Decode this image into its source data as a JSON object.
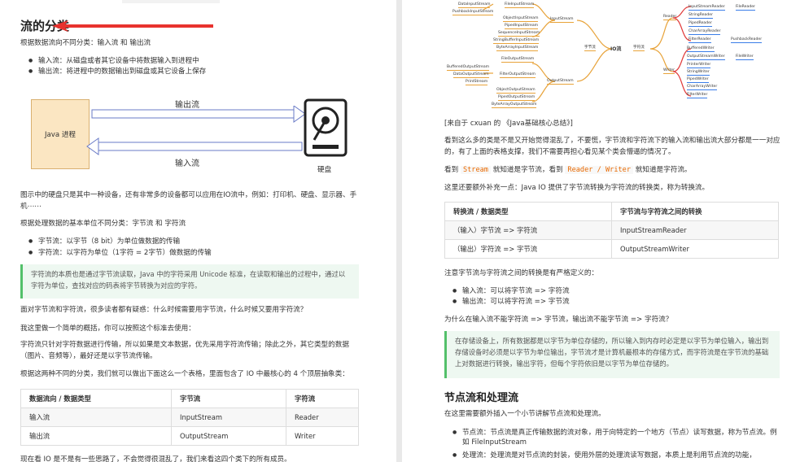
{
  "left": {
    "heading": "流的分类",
    "p1": "根据数据流向不同分类：输入流 和 输出流",
    "flow_bullets": [
      "输入流：从磁盘或者其它设备中将数据输入到进程中",
      "输出流：将进程中的数据输出到磁盘或其它设备上保存"
    ],
    "diagram": {
      "process_label": "Java 进程",
      "output_label": "输出流",
      "input_label": "输入流",
      "disk_label": "硬盘"
    },
    "p2": "图示中的硬盘只是其中一种设备，还有非常多的设备都可以应用在IO流中，例如：打印机、硬盘、显示器、手机⋯⋯",
    "p3": "根据处理数据的基本单位不同分类：字节流 和 字符流",
    "unit_bullets": [
      "字节流：以字节（8 bit）为单位做数据的传输",
      "字符流：以字符为单位（1字符 = 2字节）做数据的传输"
    ],
    "note": "字符流的本质也是通过字节流读取，Java 中的字符采用 Unicode 标准，在读取和输出的过程中，通过以字符为单位，查找对应的码表将字节转换为对应的字符。",
    "p4": "面对字节流和字符流，很多读者都有疑惑：什么时候需要用字节流，什么时候又要用字符流？",
    "p5": "我这里做一个简单的概括，你可以按照这个标准去使用：",
    "p6": "字符流只针对字符数据进行传输，所以如果是文本数据，优先采用字符流传输；除此之外，其它类型的数据（图片、音频等），最好还是以字节流传输。",
    "p7": "根据这两种不同的分类，我们就可以做出下面这么一个表格，里面包含了 IO 中最核心的 4 个顶层抽象类：",
    "table": {
      "headers": [
        "数据流向 / 数据类型",
        "字节流",
        "字符流"
      ],
      "rows": [
        [
          "输入流",
          "InputStream",
          "Reader"
        ],
        [
          "输出流",
          "OutputStream",
          "Writer"
        ]
      ]
    },
    "p8": "现在看 IO 是不是有一些思路了，不会觉得很混乱了，我们来看这四个类下的所有成员。"
  },
  "right": {
    "mindmap": {
      "center": "IO流",
      "byte": "字节流",
      "char": "字符流",
      "input_stream": "InputStream",
      "output_stream": "OutputStream",
      "reader": "Reader",
      "writer": "Writer",
      "in_children": [
        "FileInputStream",
        "ObjectInputStream",
        "PipedInputStream",
        "SequenceInputStream",
        "StringBufferInputStream",
        "ByteArrayInputStream"
      ],
      "in_far": [
        "DataInputStream",
        "PushbackInputStream"
      ],
      "out_children": [
        "FileOutputStream",
        "FilterOutputStream",
        "ObjectOutputStream",
        "PipedOutputStream",
        "ByteArrayOutputStream"
      ],
      "out_far": [
        "BufferedOutputStream",
        "DataOutputStream",
        "PrintStream"
      ],
      "reader_children": [
        "InputStreamReader",
        "StringReader",
        "PipedReader",
        "CharArrayReader",
        "FilterReader"
      ],
      "reader_far": [
        "FileReader",
        "PushbackReader"
      ],
      "writer_children": [
        "BufferedWriter",
        "OutputStreamWriter",
        "PrinterWriter",
        "StringWriter",
        "PipedWriter",
        "CharArrayWriter",
        "FilterWriter"
      ],
      "writer_far": [
        "FileWriter"
      ]
    },
    "caption": "[来自于 cxuan 的 《Java基础核心总结》]",
    "p1": "看到这么多的类是不是又开始觉得混乱了，不要慌，字节流和字符流下的输入流和输出流大部分都是一一对应的，有了上面的表格支撑，我们不需要再担心看见某个类会懵逼的情况了。",
    "p2_pre": "看到",
    "p2_code1": "Stream",
    "p2_mid": "就知道是字节流，看到",
    "p2_code2": "Reader / Writer",
    "p2_post": "就知道是字符流。",
    "p3": "这里还要额外补充一点：Java IO 提供了字节流转换为字符流的转换类，称为转换流。",
    "table": {
      "headers": [
        "转换流 / 数据类型",
        "字节流与字符流之间的转换"
      ],
      "rows": [
        [
          "（输入）字节流 => 字符流",
          "InputStreamReader"
        ],
        [
          "（输出）字符流 => 字节流",
          "OutputStreamWriter"
        ]
      ]
    },
    "p4": "注意字节流与字符流之间的转换是有严格定义的：",
    "conv_bullets": [
      "输入流：可以将字节流 => 字符流",
      "输出流：可以将字符流 => 字节流"
    ],
    "p5": "为什么在输入流不能字符流 => 字节流，输出流不能字节流 => 字符流？",
    "note": "在存储设备上，所有数据都是以字节为单位存储的，所以输入到内存时必定是以字节为单位输入，输出到存储设备时必须是以字节为单位输出，字节流才是计算机最根本的存储方式，而字符流是在字节流的基础上对数据进行转换，输出字符，但每个字符依旧是以字节为单位存储的。",
    "heading": "节点流和处理流",
    "p6": "在这里需要额外插入一个小节讲解节点流和处理流。",
    "node_bullets": [
      "节点流：节点流是真正传输数据的流对象，用于向特定的一个地方（节点）读写数据，称为节点流。例如 FileInputStream",
      "处理流：处理流是对节点流的封装，使用外层的处理流读写数据，本质上是利用节点流的功能，"
    ]
  }
}
